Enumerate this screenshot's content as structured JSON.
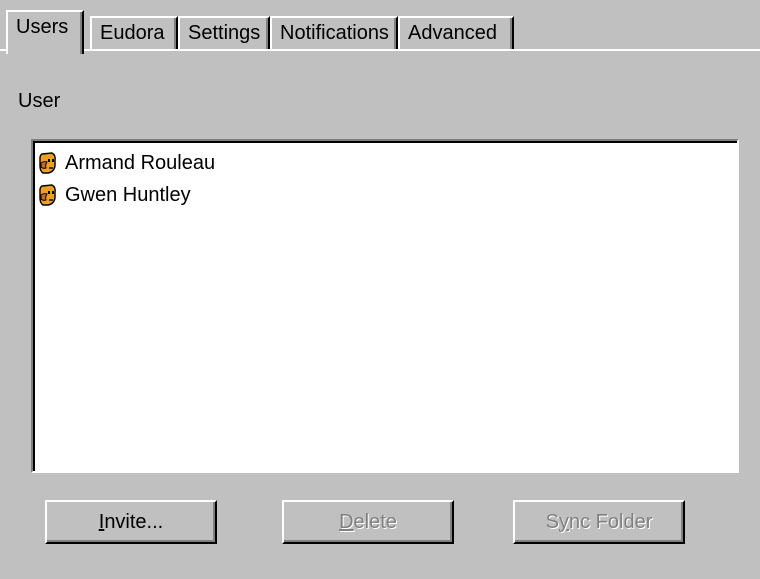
{
  "tabs": [
    {
      "label": "Users",
      "active": true
    },
    {
      "label": "Eudora",
      "active": false
    },
    {
      "label": "Settings",
      "active": false
    },
    {
      "label": "Notifications",
      "active": false
    },
    {
      "label": "Advanced",
      "active": false
    }
  ],
  "users_panel": {
    "group_label": "User",
    "users": [
      {
        "name": "Armand Rouleau",
        "icon": "user-face-icon"
      },
      {
        "name": "Gwen Huntley",
        "icon": "user-face-icon"
      }
    ]
  },
  "buttons": {
    "invite": {
      "mnemonic": "I",
      "rest": "nvite...",
      "enabled": true
    },
    "delete": {
      "mnemonic": "D",
      "rest": "elete",
      "enabled": false
    },
    "sync_folder": {
      "pre": "S",
      "mnemonic": "y",
      "rest": "nc Folder",
      "enabled": false
    }
  },
  "colors": {
    "face": "#c0c0c0",
    "highlight": "#ffffff",
    "shadow": "#808080",
    "dark_shadow": "#000000",
    "icon_orange": "#f0a020"
  }
}
